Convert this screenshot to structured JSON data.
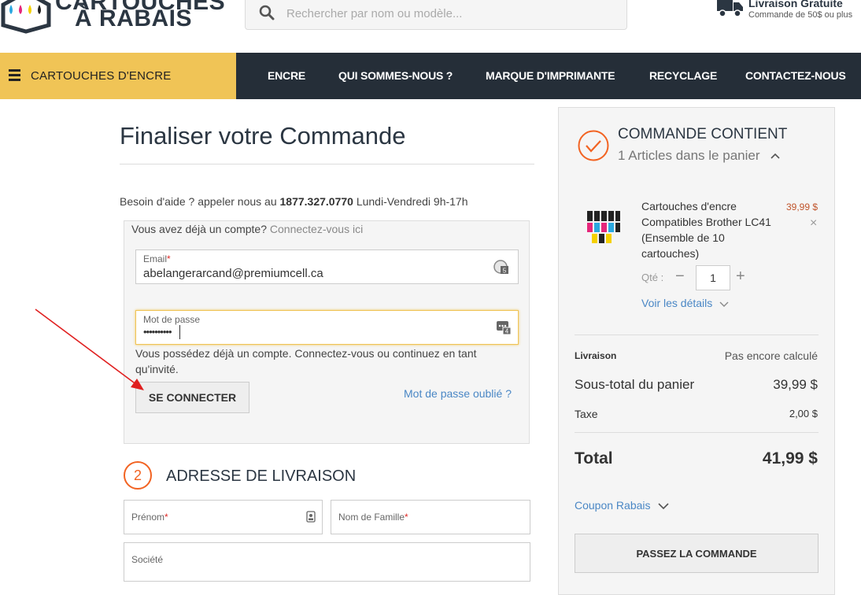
{
  "header": {
    "logo_line1": "CARTOUCHES",
    "logo_line2": "À RABAIS",
    "search_placeholder": "Rechercher par nom ou modèle...",
    "shipping_title": "Livraison Gratuite",
    "shipping_sub": "Commande de 50$ ou plus"
  },
  "nav": {
    "category_label": "CARTOUCHES D'ENCRE",
    "links": [
      "ENCRE",
      "QUI SOMMES-NOUS ?",
      "MARQUE D'IMPRIMANTE",
      "RECYCLAGE",
      "CONTACTEZ-NOUS"
    ]
  },
  "checkout": {
    "title": "Finaliser votre Commande",
    "help_prefix": "Besoin d'aide ? appeler nous au ",
    "help_phone": "1877.327.0770",
    "help_suffix": " Lundi-Vendredi 9h-17h",
    "login": {
      "question": "Vous avez déjà un compte? ",
      "question_link": "Connectez-vous ici",
      "email_label": "Email",
      "email_value": "abelangerarcand@premiumcell.ca",
      "password_label": "Mot de passe",
      "password_value": "••••••••••",
      "hint": "Vous possédez déjà un compte. Connectez-vous ou continuez en tant qu'invité.",
      "login_button": "SE CONNECTER",
      "forgot_link": "Mot de passe oublié ?"
    },
    "shipping_step": {
      "number": "2",
      "title": "ADRESSE DE LIVRAISON",
      "firstname_label": "Prénom",
      "lastname_label": "Nom de Famille",
      "company_label": "Société"
    }
  },
  "summary": {
    "title": "COMMANDE CONTIENT",
    "count": "1 Articles dans le panier",
    "item": {
      "name": "Cartouches d'encre Compatibles Brother LC41 (Ensemble de 10 cartouches)",
      "price": "39,99 $",
      "qty_label": "Qté :",
      "qty": "1",
      "details": "Voir les détails"
    },
    "shipping_label": "Livraison",
    "shipping_value": "Pas encore calculé",
    "subtotal_label": "Sous-total du panier",
    "subtotal_value": "39,99 $",
    "tax_label": "Taxe",
    "tax_value": "2,00 $",
    "total_label": "Total",
    "total_value": "41,99 $",
    "coupon": "Coupon Rabais",
    "order_button": "PASSEZ LA COMMANDE"
  },
  "colors": {
    "nav_bg": "#252e38",
    "category_bg": "#f0c456",
    "accent": "#f26322",
    "link": "#4a87c5",
    "annotation_arrow": "#e02020"
  }
}
